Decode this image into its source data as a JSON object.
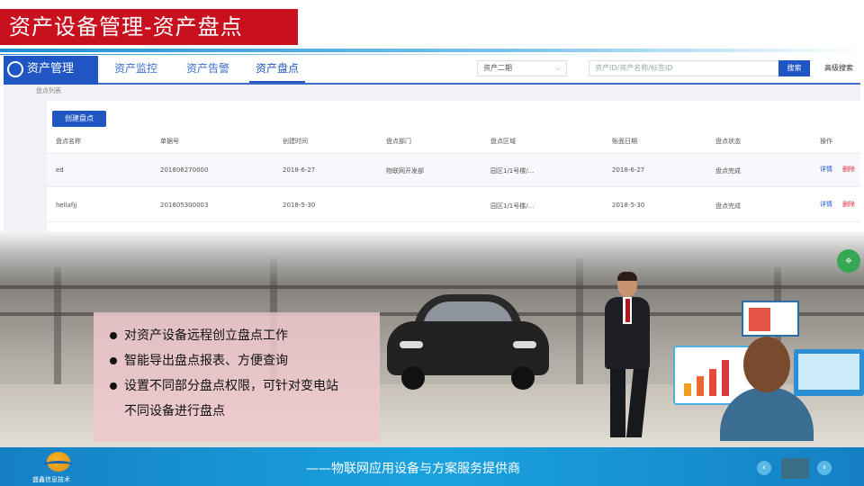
{
  "slide": {
    "title": "资产设备管理-资产盘点"
  },
  "app": {
    "logo_text": "资产管理",
    "nav_tabs": [
      {
        "label": "资产监控"
      },
      {
        "label": "资产告警"
      },
      {
        "label": "资产盘点"
      }
    ],
    "active_tab": "资产盘点",
    "select_value": "资产二期",
    "search_placeholder": "资产ID/资产名称/标签ID",
    "search_button": "搜索",
    "advanced_search": "高级搜索",
    "breadcrumb": "盘点列表",
    "create_button": "创建盘点",
    "table": {
      "headers": [
        "盘点名称",
        "单据号",
        "创建时间",
        "盘点部门",
        "盘点区域",
        "账面日期",
        "盘点状态",
        "操作"
      ],
      "rows": [
        {
          "name": "ed",
          "doc_no": "201806270000",
          "created": "2018-6-27",
          "dept": "物联网开发部",
          "area": "园区1/1号楼/...",
          "book_date": "2018-6-27",
          "status": "盘点完成",
          "detail": "详情",
          "delete": "删除"
        },
        {
          "name": "hellafjj",
          "doc_no": "201805300003",
          "created": "2018-5-30",
          "dept": "",
          "area": "园区1/1号楼/...",
          "book_date": "2018-5-30",
          "status": "盘点完成",
          "detail": "详情",
          "delete": "删除"
        }
      ]
    }
  },
  "features": [
    "对资产设备远程创立盘点工作",
    "智能导出盘点报表、方便查询",
    "设置不同部分盘点权限，可针对变电站",
    "不同设备进行盘点"
  ],
  "footer": {
    "logo_text": "盛鑫信息技术",
    "slogan": "——物联网应用设备与方案服务提供商",
    "prev_icon": "chevron-left-icon",
    "next_icon": "chevron-right-icon"
  },
  "colors": {
    "title_red": "#c8101e",
    "primary_blue": "#1f56c4",
    "footer_blue": "#1aa3df",
    "bullet_box": "#eec8cd"
  }
}
